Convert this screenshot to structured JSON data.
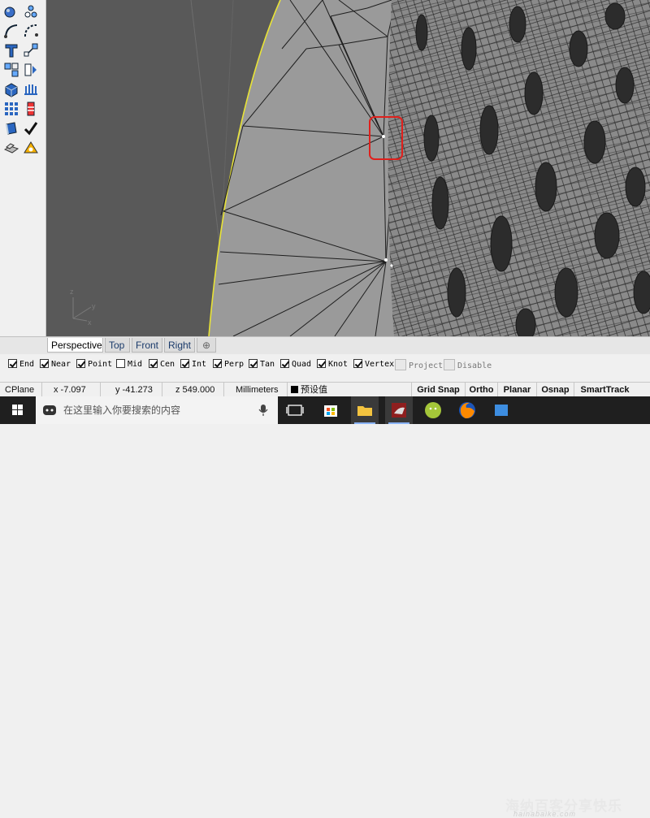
{
  "viewport": {
    "tabs": [
      {
        "label": "Perspective"
      },
      {
        "label": "Top"
      },
      {
        "label": "Front"
      },
      {
        "label": "Right"
      }
    ],
    "add_tab_icon": "plus-icon",
    "axis": {
      "x": "x",
      "y": "y",
      "z": "z"
    },
    "colors": {
      "background": "#595959",
      "mesh": "#9a9a9a",
      "edge": "#e8e337",
      "highlight": "#e0201c"
    }
  },
  "osnap": {
    "items": [
      {
        "label": "End",
        "checked": true
      },
      {
        "label": "Near",
        "checked": true
      },
      {
        "label": "Point",
        "checked": true
      },
      {
        "label": "Mid",
        "checked": false
      },
      {
        "label": "Cen",
        "checked": true
      },
      {
        "label": "Int",
        "checked": true
      },
      {
        "label": "Perp",
        "checked": true
      },
      {
        "label": "Tan",
        "checked": true
      },
      {
        "label": "Quad",
        "checked": true
      },
      {
        "label": "Knot",
        "checked": true
      },
      {
        "label": "Vertex",
        "checked": true
      },
      {
        "label": "Project",
        "checked": false
      },
      {
        "label": "Disable",
        "checked": false
      }
    ]
  },
  "status": {
    "cplane": "CPlane",
    "x": "x -7.097",
    "y": "y -41.273",
    "z": "z 549.000",
    "units": "Millimeters",
    "layer": "预设值",
    "panes": [
      "Grid Snap",
      "Ortho",
      "Planar",
      "Osnap",
      "SmartTrack"
    ]
  },
  "taskbar": {
    "search_placeholder": "在这里输入你要搜索的内容",
    "watermark": "海纳百客分享快乐",
    "watermark_sub": "hainabaike.com"
  }
}
